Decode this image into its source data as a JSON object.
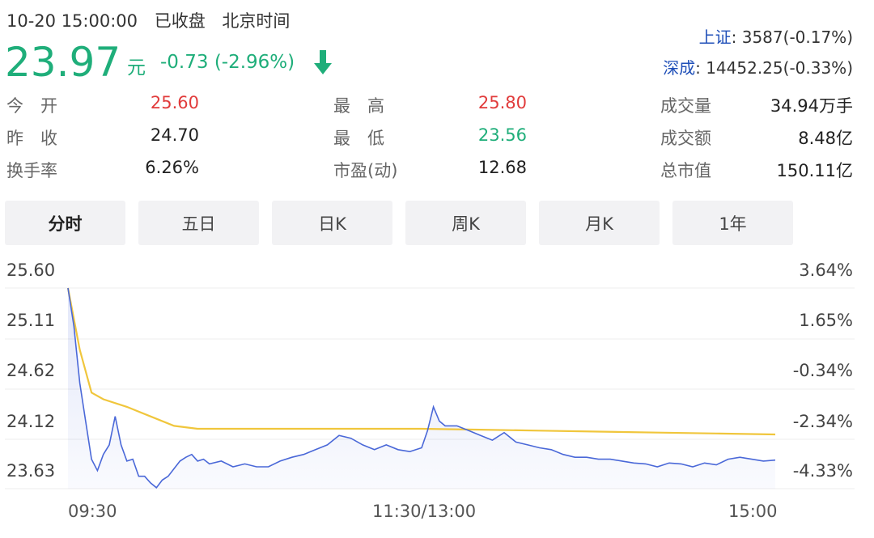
{
  "header": {
    "datetime": "10-20 15:00:00",
    "status": "已收盘",
    "timezone": "北京时间",
    "price": "23.97",
    "unit": "元",
    "change": "-0.73 (-2.96%)",
    "trend_icon": "arrow-down-icon"
  },
  "indices": [
    {
      "name": "上证",
      "value": ": 3587(-0.17%)"
    },
    {
      "name": "深成",
      "value": ": 14452.25(-0.33%)"
    }
  ],
  "stats": {
    "open_label": "今　开",
    "open": "25.60",
    "prev_close_label": "昨　收",
    "prev_close": "24.70",
    "turnover_label": "换手率",
    "turnover": "6.26%",
    "high_label": "最　高",
    "high": "25.80",
    "low_label": "最　低",
    "low": "23.56",
    "pe_label": "市盈(动)",
    "pe": "12.68",
    "volume_label": "成交量",
    "volume": "34.94万手",
    "amount_label": "成交额",
    "amount": "8.48亿",
    "mktcap_label": "总市值",
    "mktcap": "150.11亿"
  },
  "tabs": [
    "分时",
    "五日",
    "日K",
    "周K",
    "月K",
    "1年"
  ],
  "active_tab": 0,
  "colors": {
    "down": "#1fae7a",
    "up": "#e13b3b",
    "price_line": "#4a68d8",
    "avg_line": "#f0c63c",
    "index_name": "#1f4fb8"
  },
  "chart_data": {
    "type": "line",
    "y_left_ticks": [
      "25.60",
      "25.11",
      "24.62",
      "24.12",
      "23.63"
    ],
    "y_right_ticks": [
      "3.64%",
      "1.65%",
      "-0.34%",
      "-2.34%",
      "-4.33%"
    ],
    "x_ticks": [
      "09:30",
      "11:30/13:00",
      "15:00"
    ],
    "ylim": [
      23.49,
      25.6
    ],
    "x_range_minutes": [
      0,
      240
    ],
    "series": [
      {
        "role": "price",
        "points": [
          [
            0,
            25.6
          ],
          [
            2,
            25.2
          ],
          [
            4,
            24.6
          ],
          [
            6,
            24.2
          ],
          [
            8,
            23.8
          ],
          [
            10,
            23.68
          ],
          [
            12,
            23.85
          ],
          [
            14,
            23.95
          ],
          [
            16,
            24.25
          ],
          [
            18,
            23.95
          ],
          [
            20,
            23.78
          ],
          [
            22,
            23.8
          ],
          [
            24,
            23.62
          ],
          [
            26,
            23.62
          ],
          [
            28,
            23.55
          ],
          [
            30,
            23.5
          ],
          [
            32,
            23.58
          ],
          [
            34,
            23.62
          ],
          [
            36,
            23.7
          ],
          [
            38,
            23.78
          ],
          [
            40,
            23.82
          ],
          [
            42,
            23.85
          ],
          [
            44,
            23.78
          ],
          [
            46,
            23.8
          ],
          [
            48,
            23.75
          ],
          [
            52,
            23.78
          ],
          [
            56,
            23.72
          ],
          [
            60,
            23.75
          ],
          [
            64,
            23.72
          ],
          [
            68,
            23.72
          ],
          [
            72,
            23.78
          ],
          [
            76,
            23.82
          ],
          [
            80,
            23.85
          ],
          [
            84,
            23.9
          ],
          [
            88,
            23.95
          ],
          [
            92,
            24.05
          ],
          [
            96,
            24.02
          ],
          [
            100,
            23.95
          ],
          [
            104,
            23.9
          ],
          [
            108,
            23.95
          ],
          [
            112,
            23.9
          ],
          [
            116,
            23.88
          ],
          [
            120,
            23.92
          ],
          [
            122,
            24.1
          ],
          [
            124,
            24.35
          ],
          [
            126,
            24.2
          ],
          [
            128,
            24.15
          ],
          [
            132,
            24.15
          ],
          [
            136,
            24.1
          ],
          [
            140,
            24.05
          ],
          [
            144,
            24.0
          ],
          [
            148,
            24.08
          ],
          [
            152,
            23.98
          ],
          [
            156,
            23.95
          ],
          [
            160,
            23.92
          ],
          [
            164,
            23.9
          ],
          [
            168,
            23.85
          ],
          [
            172,
            23.82
          ],
          [
            176,
            23.82
          ],
          [
            180,
            23.8
          ],
          [
            184,
            23.8
          ],
          [
            188,
            23.78
          ],
          [
            192,
            23.76
          ],
          [
            196,
            23.75
          ],
          [
            200,
            23.72
          ],
          [
            204,
            23.76
          ],
          [
            208,
            23.75
          ],
          [
            212,
            23.72
          ],
          [
            216,
            23.76
          ],
          [
            220,
            23.74
          ],
          [
            224,
            23.8
          ],
          [
            228,
            23.82
          ],
          [
            232,
            23.8
          ],
          [
            236,
            23.78
          ],
          [
            240,
            23.79
          ]
        ]
      },
      {
        "role": "average",
        "points": [
          [
            0,
            25.6
          ],
          [
            4,
            24.95
          ],
          [
            8,
            24.5
          ],
          [
            12,
            24.43
          ],
          [
            20,
            24.35
          ],
          [
            28,
            24.25
          ],
          [
            36,
            24.15
          ],
          [
            44,
            24.12
          ],
          [
            60,
            24.12
          ],
          [
            80,
            24.12
          ],
          [
            100,
            24.12
          ],
          [
            120,
            24.12
          ],
          [
            140,
            24.11
          ],
          [
            160,
            24.1
          ],
          [
            180,
            24.09
          ],
          [
            200,
            24.08
          ],
          [
            220,
            24.07
          ],
          [
            240,
            24.06
          ]
        ]
      }
    ]
  }
}
